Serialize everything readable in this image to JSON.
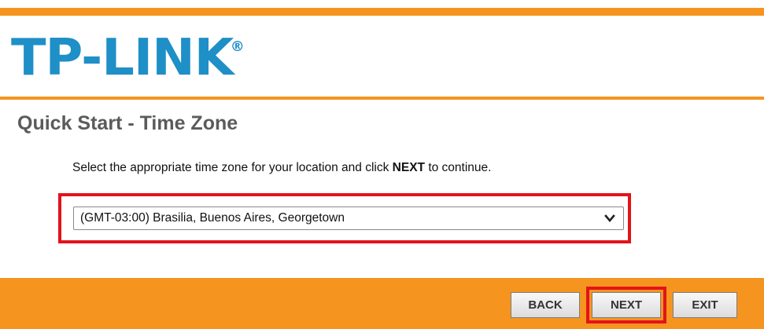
{
  "header": {
    "logo_text": "TP-LINK",
    "logo_mark": "®"
  },
  "page": {
    "title": "Quick Start - Time Zone",
    "instruction_prefix": "Select the appropriate time zone for your location and click ",
    "instruction_bold": "NEXT",
    "instruction_suffix": " to continue."
  },
  "timezone_select": {
    "selected": "(GMT-03:00) Brasilia, Buenos Aires, Georgetown",
    "icon": "chevron-down-icon"
  },
  "buttons": {
    "back": "BACK",
    "next": "NEXT",
    "exit": "EXIT"
  },
  "colors": {
    "brand_orange": "#f5951f",
    "logo_blue": "#1f8fc7",
    "highlight_red": "#e3131b",
    "title_gray": "#5b5b5b"
  }
}
